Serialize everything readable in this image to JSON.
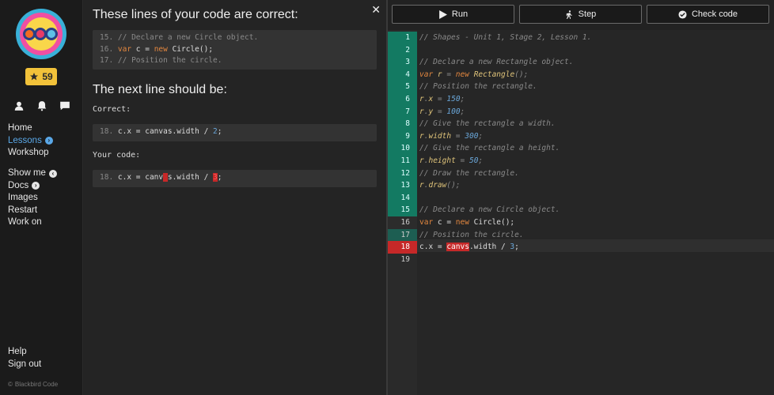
{
  "sidebar": {
    "stars": "59",
    "icons": [
      "user-icon",
      "bell-icon",
      "chat-icon"
    ],
    "nav_main": [
      "Home",
      "Lessons",
      "Workshop"
    ],
    "nav_tools": [
      "Show me",
      "Docs",
      "Images",
      "Restart",
      "Work on"
    ],
    "nav_bottom": [
      "Help",
      "Sign out"
    ],
    "copyright": "Blackbird Code"
  },
  "middle": {
    "heading_correct": "These lines of your code are correct:",
    "prev_lines": [
      {
        "n": "15.",
        "text": "// Declare a new Circle object."
      },
      {
        "n": "16.",
        "kw": "var",
        "a": " c = ",
        "kw2": "new",
        "b": " Circle();"
      },
      {
        "n": "17.",
        "text": "// Position the circle."
      }
    ],
    "heading_next": "The next line should be:",
    "label_correct": "Correct:",
    "correct_line": {
      "n": "18.",
      "a": "c.x = canvas.width / ",
      "num": "2",
      "end": ";"
    },
    "label_your": "Your code:",
    "your_line": {
      "n": "18.",
      "a": "c.x = canv",
      "err1": "a",
      "b": "s.width / ",
      "err2": "3",
      "end": ";"
    }
  },
  "toolbar": {
    "run": "Run",
    "step": "Step",
    "check": "Check code"
  },
  "editor": {
    "line_numbers": [
      "1",
      "2",
      "3",
      "4",
      "5",
      "6",
      "7",
      "8",
      "9",
      "10",
      "11",
      "12",
      "13",
      "14",
      "15",
      "16",
      "17",
      "18",
      "19"
    ],
    "lines": {
      "l1": "// Shapes - Unit 1, Stage 2, Lesson 1.",
      "l3": "// Declare a new Rectangle object.",
      "l5": "// Position the rectangle.",
      "l8": "// Give the rectangle a width.",
      "l10": "// Give the rectangle a height.",
      "l12": "// Draw the rectangle.",
      "l15": "// Declare a new Circle object.",
      "l17": "// Position the circle."
    },
    "values": {
      "x": "150",
      "y": "100",
      "width": "300",
      "height": "50",
      "div": "3"
    }
  }
}
